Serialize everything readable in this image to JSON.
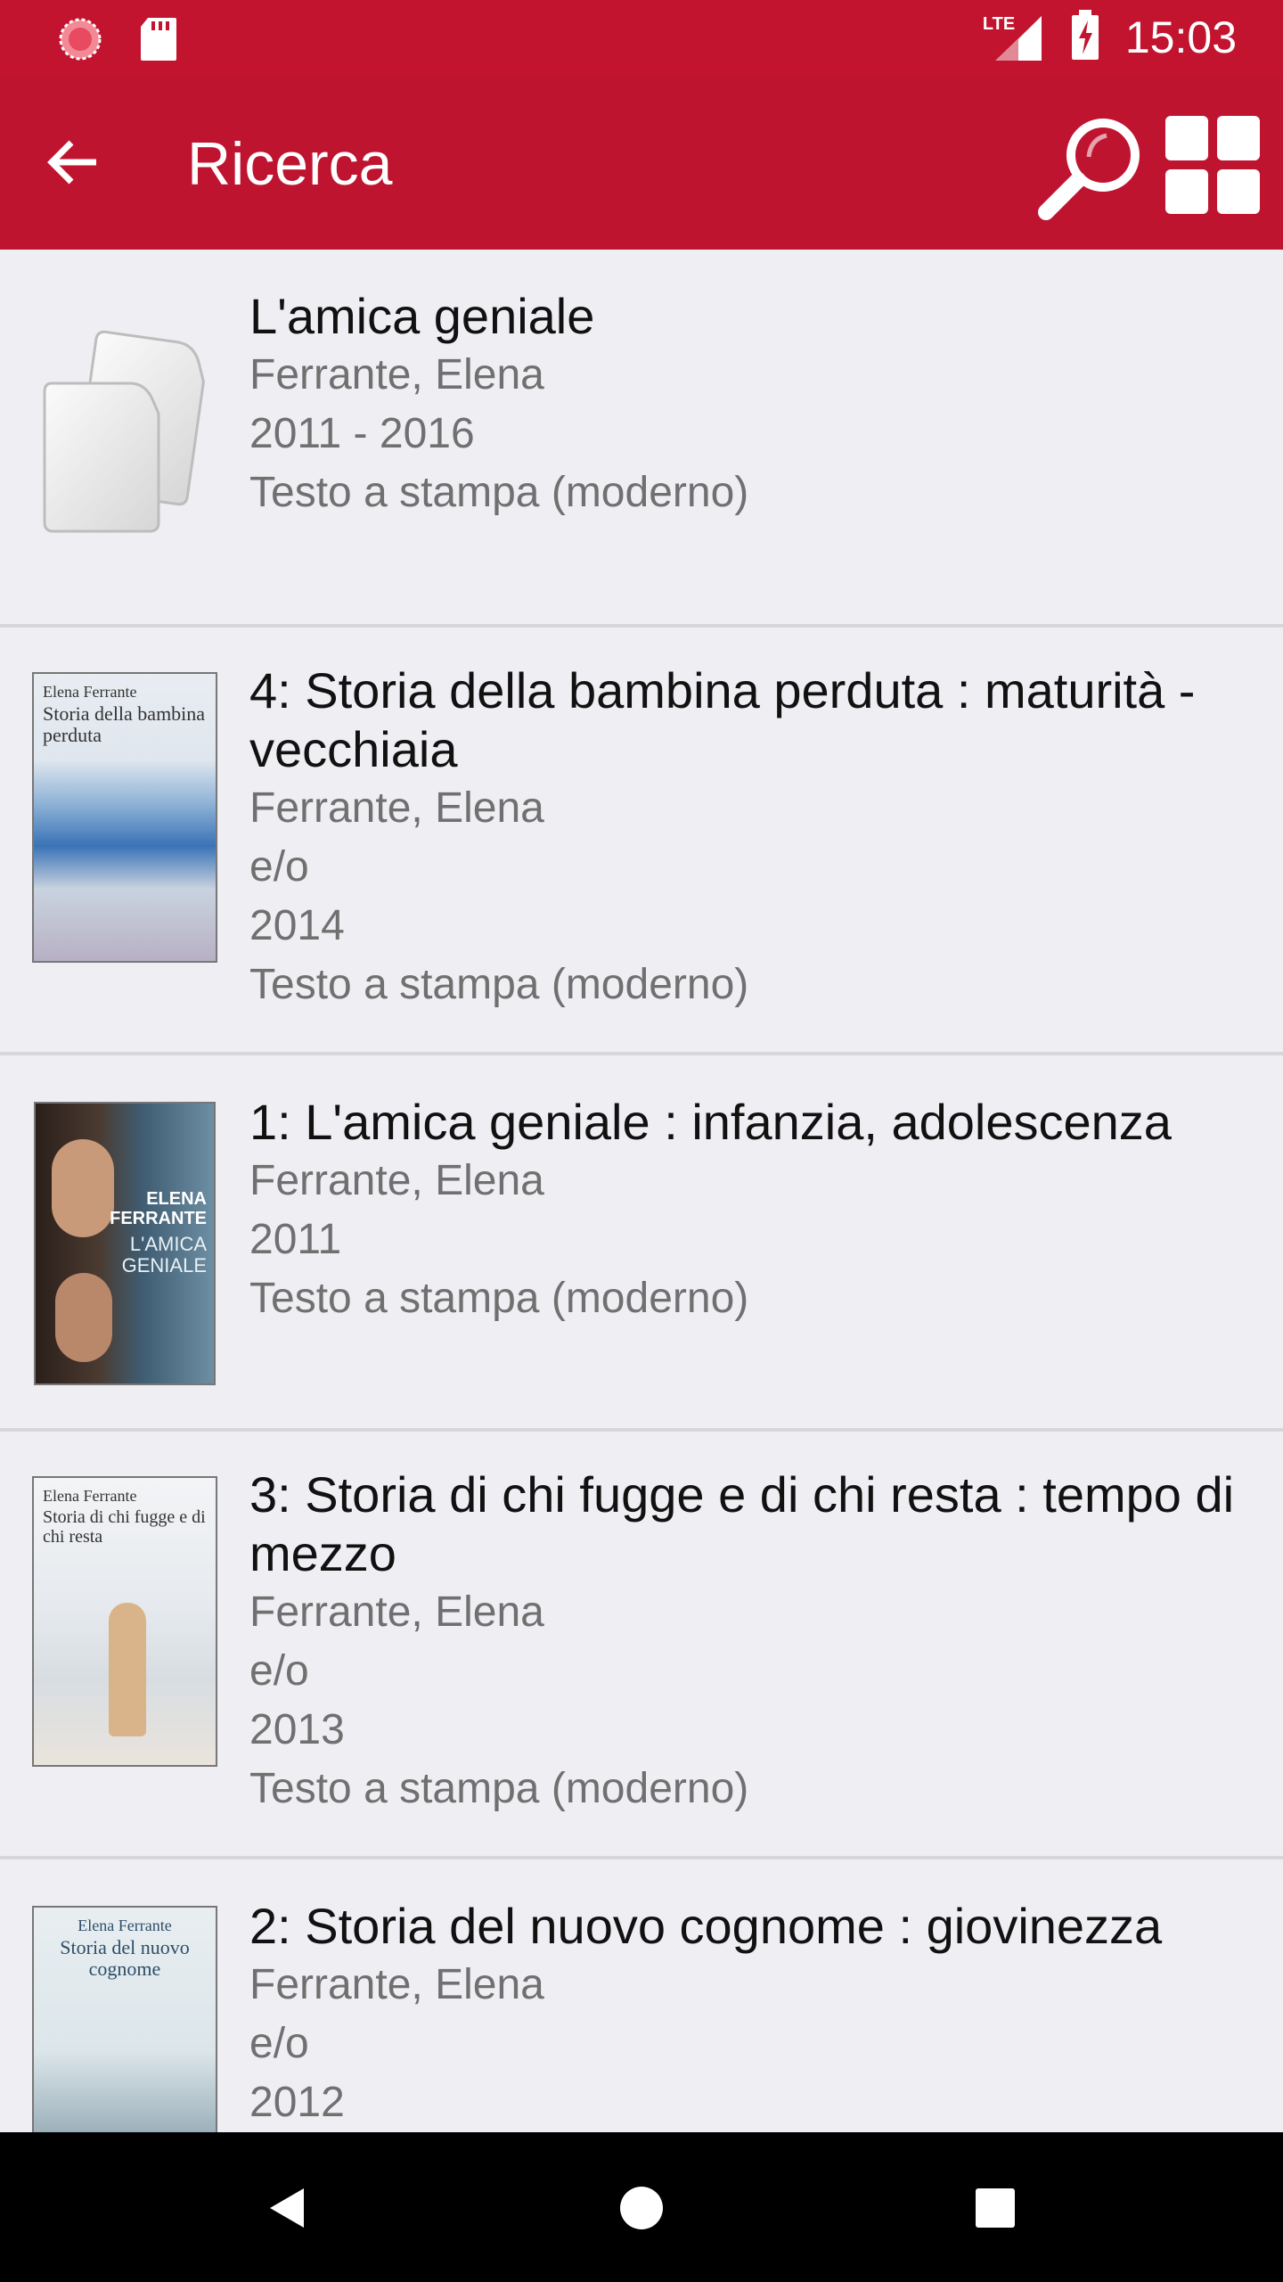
{
  "status_bar": {
    "time": "15:03",
    "network_label": "LTE",
    "icons": [
      "record-icon",
      "sd-card-icon",
      "lte-signal-icon",
      "battery-charging-icon"
    ]
  },
  "app_bar": {
    "title": "Ricerca",
    "icons": [
      "back-arrow-icon",
      "search-icon",
      "grid-view-icon"
    ],
    "color": "#bf1430"
  },
  "results": [
    {
      "title": "L'amica geniale",
      "lines": [
        "Ferrante, Elena",
        "2011 - 2016",
        "Testo a stampa (moderno)"
      ],
      "thumbnail": "documents-placeholder-icon"
    },
    {
      "title": "4: Storia della bambina perduta : maturità - vecchiaia",
      "lines": [
        "Ferrante, Elena",
        "e/o",
        "2014",
        "Testo a stampa (moderno)"
      ],
      "thumbnail": "book-cover",
      "cover_author": "Elena Ferrante",
      "cover_title": "Storia della bambina perduta"
    },
    {
      "title": "1: L'amica geniale : infanzia, adolescenza",
      "lines": [
        "Ferrante, Elena",
        "2011",
        "Testo a stampa (moderno)"
      ],
      "thumbnail": "book-cover",
      "cover_author": "ELENA FERRANTE",
      "cover_title": "L'AMICA GENIALE"
    },
    {
      "title": "3: Storia di chi fugge e di chi resta : tempo di mezzo",
      "lines": [
        "Ferrante, Elena",
        "e/o",
        "2013",
        "Testo a stampa (moderno)"
      ],
      "thumbnail": "book-cover",
      "cover_author": "Elena Ferrante",
      "cover_title": "Storia di chi fugge e di chi resta"
    },
    {
      "title": "2: Storia del nuovo cognome : giovinezza",
      "lines": [
        "Ferrante, Elena",
        "e/o",
        "2012"
      ],
      "thumbnail": "book-cover",
      "cover_author": "Elena Ferrante",
      "cover_title": "Storia del nuovo cognome"
    }
  ],
  "nav_bar": {
    "icons": [
      "back-triangle-icon",
      "home-circle-icon",
      "recents-square-icon"
    ]
  }
}
